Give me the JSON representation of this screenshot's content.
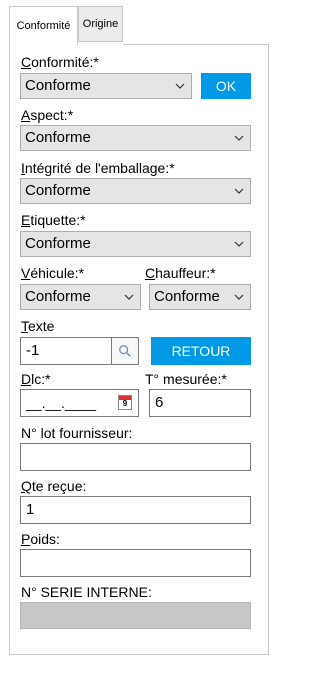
{
  "tabs": [
    {
      "label": "Conformité",
      "active": true
    },
    {
      "label": "Origine",
      "active": false
    }
  ],
  "form": {
    "conformite": {
      "label_u": "C",
      "label_rest": "onformité:*",
      "value": "Conforme",
      "ok_label": "OK"
    },
    "aspect": {
      "label_u": "A",
      "label_rest": "spect:*",
      "value": "Conforme"
    },
    "integrite": {
      "label_u": "I",
      "label_rest": "ntégrité de l'emballage:*",
      "value": "Conforme"
    },
    "etiquette": {
      "label_u": "E",
      "label_rest": "tiquette:*",
      "value": "Conforme"
    },
    "vehicule": {
      "label_u": "V",
      "label_rest": "éhicule:*",
      "value": "Conforme"
    },
    "chauffeur": {
      "label_u": "C",
      "label_rest": "hauffeur:*",
      "value": "Conforme"
    },
    "texte": {
      "label_u": "T",
      "label_rest": "exte",
      "value": "-1",
      "retour_label": "RETOUR"
    },
    "dlc": {
      "label_u": "D",
      "label_rest": "lc:*",
      "value": "__.__.____",
      "calendar_day": "9"
    },
    "temperature": {
      "label": "T° mesurée:*",
      "value": "6"
    },
    "lot_fournisseur": {
      "label": "N° lot fournisseur:",
      "value": ""
    },
    "qte_recue": {
      "label_u": "Q",
      "label_rest": "te reçue:",
      "value": "1"
    },
    "poids": {
      "label_u": "P",
      "label_rest": "oids:",
      "value": ""
    },
    "serie_interne": {
      "label": "N° SERIE INTERNE:",
      "value": ""
    }
  },
  "colors": {
    "accent": "#0099e6",
    "select_bg": "#e5e5e5",
    "disabled_bg": "#c8c8c8"
  }
}
